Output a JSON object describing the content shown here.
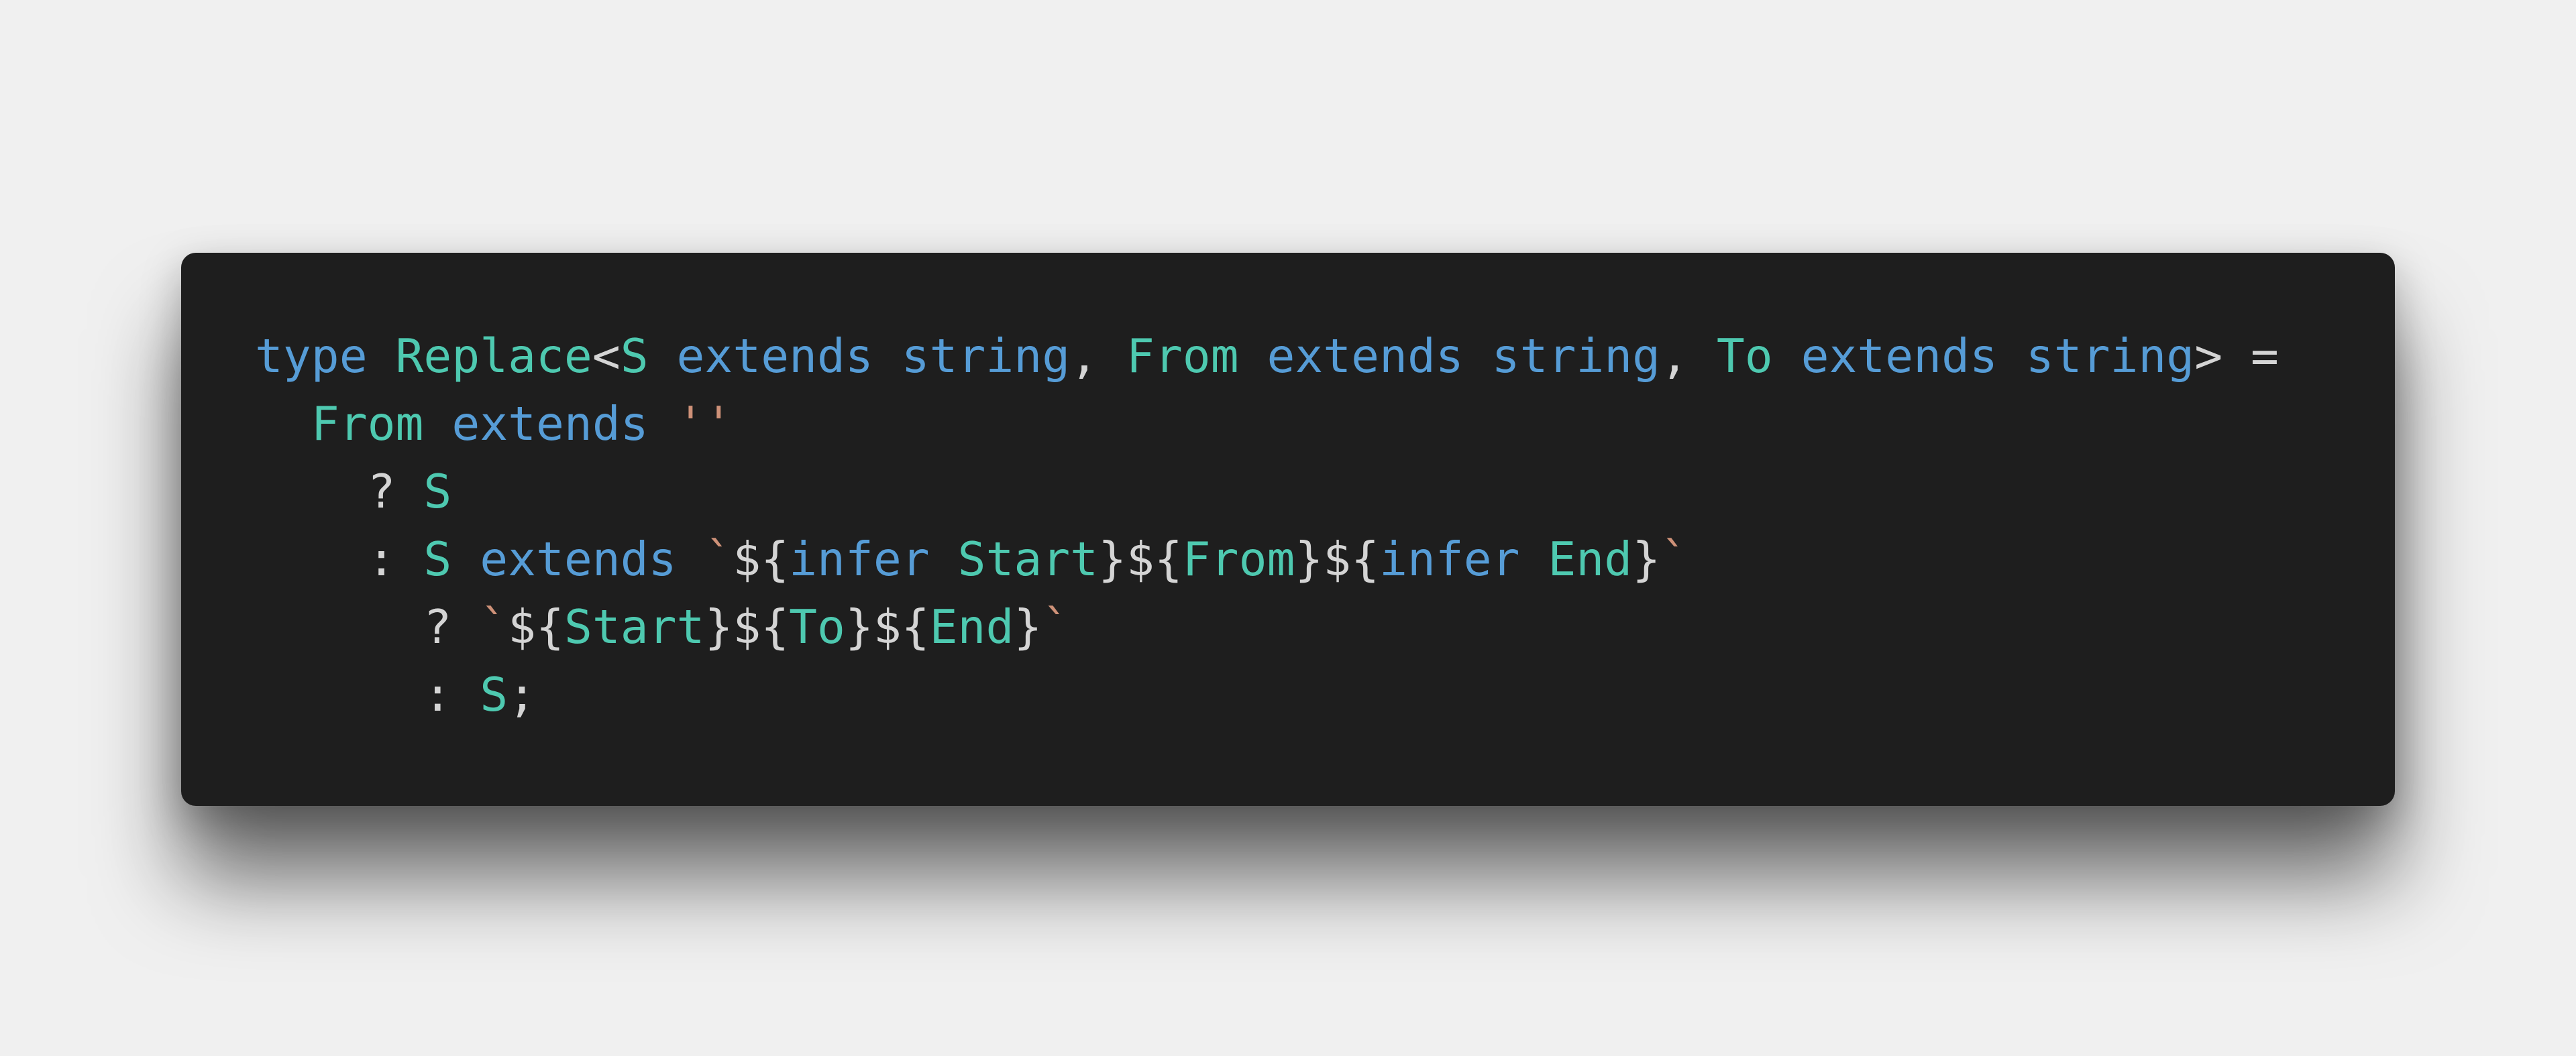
{
  "colors": {
    "background": "#f0f0f0",
    "card": "#1e1e1e",
    "keyword": "#569cd6",
    "type": "#4ec9b0",
    "string": "#ce9178",
    "punctuation": "#d4d4d4"
  },
  "code": {
    "language": "typescript",
    "lines": [
      {
        "indent": "",
        "tokens": [
          {
            "t": "type",
            "k": "kw"
          },
          {
            "t": " ",
            "k": "pn"
          },
          {
            "t": "Replace",
            "k": "ty"
          },
          {
            "t": "<",
            "k": "pn"
          },
          {
            "t": "S",
            "k": "ty"
          },
          {
            "t": " ",
            "k": "pn"
          },
          {
            "t": "extends",
            "k": "kw"
          },
          {
            "t": " ",
            "k": "pn"
          },
          {
            "t": "string",
            "k": "kw"
          },
          {
            "t": ", ",
            "k": "pn"
          },
          {
            "t": "From",
            "k": "ty"
          },
          {
            "t": " ",
            "k": "pn"
          },
          {
            "t": "extends",
            "k": "kw"
          },
          {
            "t": " ",
            "k": "pn"
          },
          {
            "t": "string",
            "k": "kw"
          },
          {
            "t": ", ",
            "k": "pn"
          },
          {
            "t": "To",
            "k": "ty"
          },
          {
            "t": " ",
            "k": "pn"
          },
          {
            "t": "extends",
            "k": "kw"
          },
          {
            "t": " ",
            "k": "pn"
          },
          {
            "t": "string",
            "k": "kw"
          },
          {
            "t": "> =",
            "k": "pn"
          }
        ]
      },
      {
        "indent": "  ",
        "tokens": [
          {
            "t": "From",
            "k": "ty"
          },
          {
            "t": " ",
            "k": "pn"
          },
          {
            "t": "extends",
            "k": "kw"
          },
          {
            "t": " ",
            "k": "pn"
          },
          {
            "t": "''",
            "k": "str"
          }
        ]
      },
      {
        "indent": "    ",
        "tokens": [
          {
            "t": "? ",
            "k": "pn"
          },
          {
            "t": "S",
            "k": "ty"
          }
        ]
      },
      {
        "indent": "    ",
        "tokens": [
          {
            "t": ": ",
            "k": "pn"
          },
          {
            "t": "S",
            "k": "ty"
          },
          {
            "t": " ",
            "k": "pn"
          },
          {
            "t": "extends",
            "k": "kw"
          },
          {
            "t": " ",
            "k": "pn"
          },
          {
            "t": "`",
            "k": "str"
          },
          {
            "t": "${",
            "k": "pn"
          },
          {
            "t": "infer",
            "k": "kw"
          },
          {
            "t": " ",
            "k": "pn"
          },
          {
            "t": "Start",
            "k": "ty"
          },
          {
            "t": "}${",
            "k": "pn"
          },
          {
            "t": "From",
            "k": "ty"
          },
          {
            "t": "}${",
            "k": "pn"
          },
          {
            "t": "infer",
            "k": "kw"
          },
          {
            "t": " ",
            "k": "pn"
          },
          {
            "t": "End",
            "k": "ty"
          },
          {
            "t": "}",
            "k": "pn"
          },
          {
            "t": "`",
            "k": "str"
          }
        ]
      },
      {
        "indent": "      ",
        "tokens": [
          {
            "t": "? ",
            "k": "pn"
          },
          {
            "t": "`",
            "k": "str"
          },
          {
            "t": "${",
            "k": "pn"
          },
          {
            "t": "Start",
            "k": "ty"
          },
          {
            "t": "}${",
            "k": "pn"
          },
          {
            "t": "To",
            "k": "ty"
          },
          {
            "t": "}${",
            "k": "pn"
          },
          {
            "t": "End",
            "k": "ty"
          },
          {
            "t": "}",
            "k": "pn"
          },
          {
            "t": "`",
            "k": "str"
          }
        ]
      },
      {
        "indent": "      ",
        "tokens": [
          {
            "t": ": ",
            "k": "pn"
          },
          {
            "t": "S",
            "k": "ty"
          },
          {
            "t": ";",
            "k": "pn"
          }
        ]
      }
    ]
  }
}
